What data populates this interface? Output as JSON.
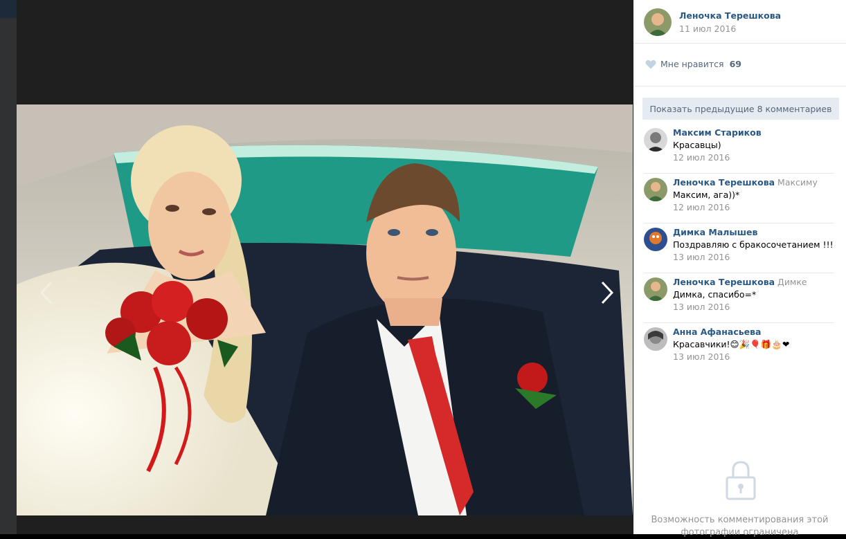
{
  "author": {
    "name": "Леночка Терешкова",
    "date": "11 июл 2016"
  },
  "likes": {
    "label": "Мне нравится",
    "count": "69"
  },
  "show_previous_label": "Показать предыдущие 8 комментариев",
  "comments": [
    {
      "author": "Максим Стариков",
      "reply_to": "",
      "text": "Красавцы)",
      "date": "12 июл 2016"
    },
    {
      "author": "Леночка Терешкова",
      "reply_to": "Максиму",
      "text": "Максим, ага))*",
      "date": "12 июл 2016"
    },
    {
      "author": "Димка Малышев",
      "reply_to": "",
      "text": "Поздравляю с бракосочетанием !!!",
      "date": "13 июл 2016"
    },
    {
      "author": "Леночка Терешкова",
      "reply_to": "Димке",
      "text": "Димка, спасибо=*",
      "date": "13 июл 2016"
    },
    {
      "author": "Анна Афанасьева",
      "reply_to": "",
      "text": "Красавчики!😊🎉🎈🎁🎂❤",
      "date": "13 июл 2016"
    }
  ],
  "restricted_text": "Возможность комментирования этой фотографии ограничена",
  "icons": {
    "prev": "chevron-left-icon",
    "next": "chevron-right-icon",
    "like": "heart-icon",
    "lock": "lock-icon"
  },
  "colors": {
    "link": "#2a5885",
    "muted": "#939393",
    "button_bg": "#e5ebf1",
    "viewer_bg": "#1f1f1f"
  }
}
